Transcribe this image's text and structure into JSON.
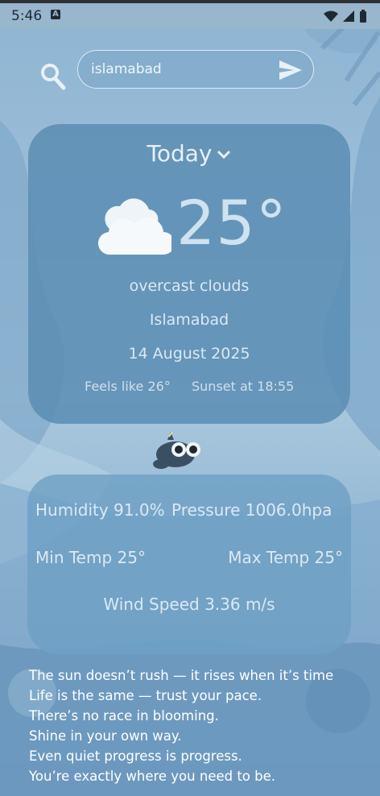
{
  "status_bar": {
    "time": "5:46",
    "app_icon": "A"
  },
  "search": {
    "value": "islamabad"
  },
  "weather": {
    "day_label": "Today",
    "icon": "overcast-cloud-icon",
    "temperature": "25°",
    "description": "overcast clouds",
    "city": "Islamabad",
    "date": "14 August 2025",
    "feels_like": "Feels like  26°",
    "sunset": "Sunset at  18:55"
  },
  "details": {
    "humidity": "Humidity 91.0%",
    "pressure": "Pressure 1006.0hpa",
    "min_temp": "Min Temp 25°",
    "max_temp": "Max Temp 25°",
    "wind_speed": "Wind Speed  3.36 m/s"
  },
  "quotes": [
    "The sun doesn’t rush — it rises when it’s time",
    "Life is the same — trust your pace.",
    "There’s no race in blooming.",
    "Shine in your own way.",
    "Even quiet progress is progress.",
    "You’re exactly where you need to be."
  ],
  "colors": {
    "background": "#7aa4c6",
    "card": "#5c8eb4",
    "text": "#dbe9f3"
  }
}
